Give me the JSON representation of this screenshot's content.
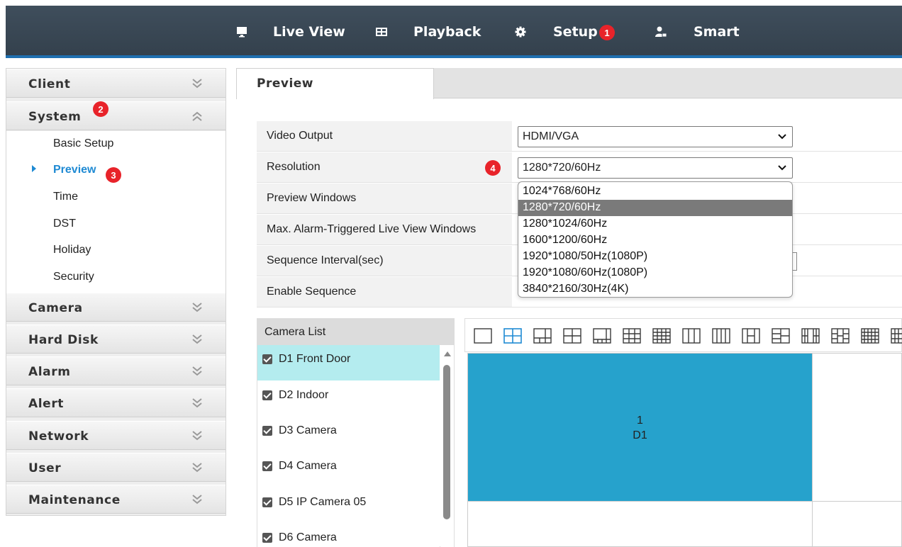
{
  "nav": {
    "items": [
      {
        "label": "Live View",
        "icon": "monitor-icon"
      },
      {
        "label": "Playback",
        "icon": "film-icon"
      },
      {
        "label": "Setup",
        "icon": "gear-icon"
      },
      {
        "label": "Smart",
        "icon": "person-lock-icon"
      }
    ],
    "setup_badge": "1"
  },
  "sidebar": {
    "sections": [
      "Client",
      "System",
      "Camera",
      "Hard Disk",
      "Alarm",
      "Alert",
      "Network",
      "User",
      "Maintenance"
    ],
    "system_badge": "2",
    "system_items": [
      "Basic Setup",
      "Preview",
      "Time",
      "DST",
      "Holiday",
      "Security"
    ],
    "preview_badge": "3"
  },
  "tab": {
    "label": "Preview"
  },
  "form": {
    "video_output_label": "Video Output",
    "video_output_value": "HDMI/VGA",
    "resolution_label": "Resolution",
    "resolution_value": "1280*720/60Hz",
    "resolution_badge": "4",
    "preview_windows_label": "Preview Windows",
    "alarm_windows_label": "Max. Alarm-Triggered Live View Windows",
    "sequence_interval_label": "Sequence Interval(sec)",
    "enable_sequence_label": "Enable Sequence"
  },
  "resolution_options": [
    "1024*768/60Hz",
    "1280*720/60Hz",
    "1280*1024/60Hz",
    "1600*1200/60Hz",
    "1920*1080/50Hz(1080P)",
    "1920*1080/60Hz(1080P)",
    "3840*2160/30Hz(4K)"
  ],
  "camera_list": {
    "header": "Camera List",
    "cameras": [
      "D1 Front Door",
      "D2 Indoor",
      "D3 Camera",
      "D4 Camera",
      "D5 IP Camera 05",
      "D6 Camera"
    ]
  },
  "grid": {
    "window_number": "1",
    "window_camera": "D1"
  },
  "colors": {
    "accent": "#1f8ad3",
    "badge": "#e8232a",
    "selected_window": "#26a2cc",
    "selected_camera": "#b4ecef"
  }
}
